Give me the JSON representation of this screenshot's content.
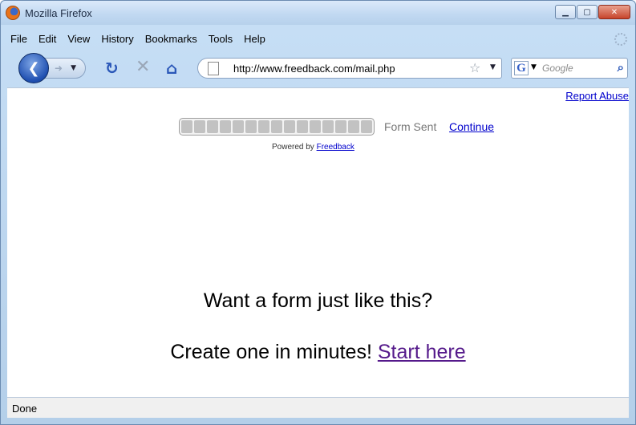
{
  "window": {
    "title": "Mozilla Firefox"
  },
  "menu": [
    "File",
    "Edit",
    "View",
    "History",
    "Bookmarks",
    "Tools",
    "Help"
  ],
  "menu_accel": [
    "F",
    "E",
    "V",
    "s",
    "B",
    "T",
    "H"
  ],
  "nav": {
    "url": "http://www.freedback.com/mail.php",
    "search_placeholder": "Google"
  },
  "page": {
    "report_abuse": "Report Abuse",
    "progress_fraction": 1.0,
    "form_sent": "Form Sent",
    "continue": "Continue",
    "powered_prefix": "Powered by",
    "powered_link": "Freedback",
    "promo_line1": "Want a form just like this?",
    "promo_line2_prefix": "Create one in minutes!",
    "promo_line2_link": "Start here"
  },
  "status": {
    "text": "Done"
  },
  "colors": {
    "link": "#0000cc",
    "visited_link": "#551a8b",
    "progress_segment": "#c2c2c2"
  }
}
